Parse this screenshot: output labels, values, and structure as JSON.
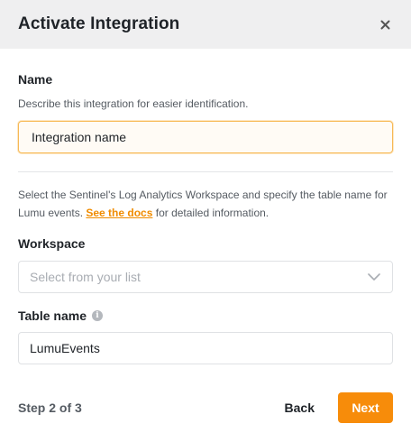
{
  "modal": {
    "title": "Activate Integration",
    "close_icon": "close-icon"
  },
  "name_section": {
    "label": "Name",
    "help": "Describe this integration for easier identification.",
    "input_value": "Integration name"
  },
  "workspace_section": {
    "description_before": "Select the Sentinel's Log Analytics Workspace and specify the table name for Lumu events. ",
    "docs_link": "See the docs",
    "description_after": " for detailed information.",
    "label": "Workspace",
    "placeholder": "Select from your list",
    "dropdown_icon": "chevron-down-icon"
  },
  "table_section": {
    "label": "Table name",
    "info_icon": "info-icon",
    "info_glyph": "i",
    "input_value": "LumuEvents"
  },
  "footer": {
    "step": "Step 2 of 3",
    "back_label": "Back",
    "next_label": "Next"
  },
  "colors": {
    "accent": "#f78c0a",
    "header_bg": "#efeff0",
    "focus_border": "#f7b955"
  }
}
